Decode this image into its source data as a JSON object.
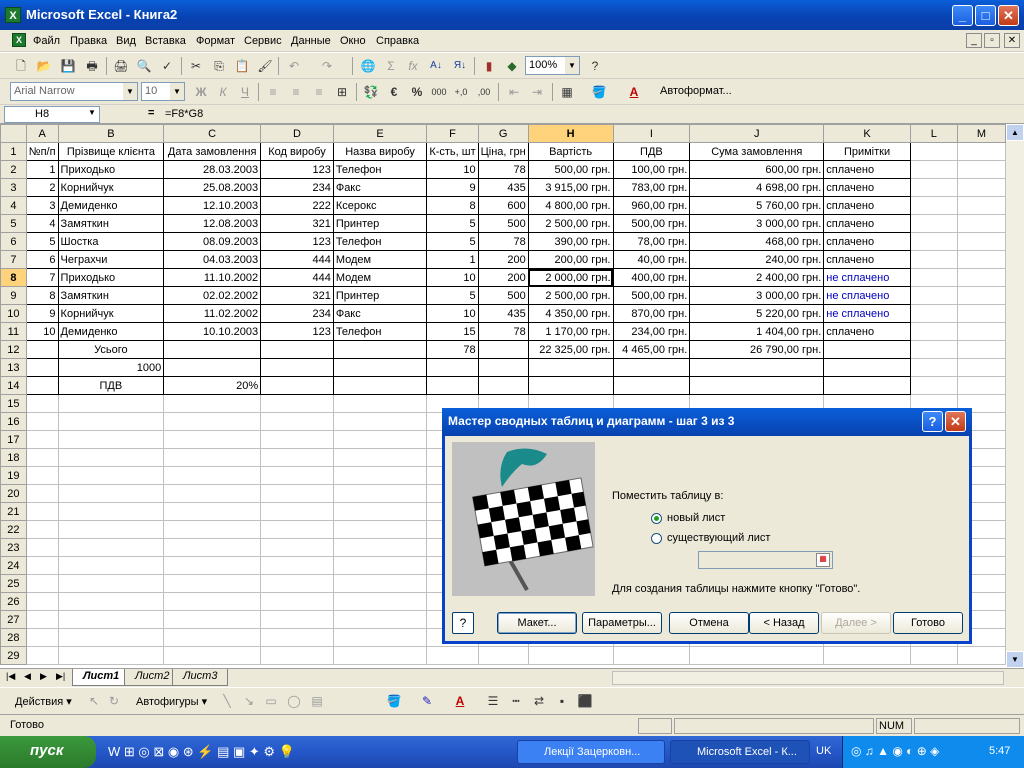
{
  "app": {
    "title": "Microsoft Excel - Книга2",
    "window_buttons": [
      "_",
      "□",
      "✕"
    ]
  },
  "menu": [
    "Файл",
    "Правка",
    "Вид",
    "Вставка",
    "Формат",
    "Сервис",
    "Данные",
    "Окно",
    "Справка"
  ],
  "toolbar": {
    "zoom": "100%",
    "font": "Arial Narrow",
    "size": "10",
    "autoformat": "Автоформат..."
  },
  "formula_bar": {
    "cell": "H8",
    "eq": "=",
    "formula": "=F8*G8"
  },
  "columns": [
    "A",
    "B",
    "C",
    "D",
    "E",
    "F",
    "G",
    "H",
    "I",
    "J",
    "K",
    "L",
    "M"
  ],
  "rows": [
    [
      "№п/п",
      "Прізвище клієнта",
      "Дата замовлення",
      "Код виробу",
      "Назва виробу",
      "К-сть, шт",
      "Ціна, грн",
      "Вартість",
      "ПДВ",
      "Сума замовлення",
      "Примітки",
      "",
      ""
    ],
    [
      "1",
      "Приходько",
      "28.03.2003",
      "123",
      "Телефон",
      "10",
      "78",
      "500,00 грн.",
      "100,00 грн.",
      "600,00 грн.",
      "сплачено",
      "",
      ""
    ],
    [
      "2",
      "Корнийчук",
      "25.08.2003",
      "234",
      "Факс",
      "9",
      "435",
      "3 915,00 грн.",
      "783,00 грн.",
      "4 698,00 грн.",
      "сплачено",
      "",
      ""
    ],
    [
      "3",
      "Демиденко",
      "12.10.2003",
      "222",
      "Ксерокс",
      "8",
      "600",
      "4 800,00 грн.",
      "960,00 грн.",
      "5 760,00 грн.",
      "сплачено",
      "",
      ""
    ],
    [
      "4",
      "Замяткин",
      "12.08.2003",
      "321",
      "Принтер",
      "5",
      "500",
      "2 500,00 грн.",
      "500,00 грн.",
      "3 000,00 грн.",
      "сплачено",
      "",
      ""
    ],
    [
      "5",
      "Шостка",
      "08.09.2003",
      "123",
      "Телефон",
      "5",
      "78",
      "390,00 грн.",
      "78,00 грн.",
      "468,00 грн.",
      "сплачено",
      "",
      ""
    ],
    [
      "6",
      "Чеграхчи",
      "04.03.2003",
      "444",
      "Модем",
      "1",
      "200",
      "200,00 грн.",
      "40,00 грн.",
      "240,00 грн.",
      "сплачено",
      "",
      ""
    ],
    [
      "7",
      "Приходько",
      "11.10.2002",
      "444",
      "Модем",
      "10",
      "200",
      "2 000,00 грн.",
      "400,00 грн.",
      "2 400,00 грн.",
      "не сплачено",
      "",
      ""
    ],
    [
      "8",
      "Замяткин",
      "02.02.2002",
      "321",
      "Принтер",
      "5",
      "500",
      "2 500,00 грн.",
      "500,00 грн.",
      "3 000,00 грн.",
      "не сплачено",
      "",
      ""
    ],
    [
      "9",
      "Корнийчук",
      "11.02.2002",
      "234",
      "Факс",
      "10",
      "435",
      "4 350,00 грн.",
      "870,00 грн.",
      "5 220,00 грн.",
      "не сплачено",
      "",
      ""
    ],
    [
      "10",
      "Демиденко",
      "10.10.2003",
      "123",
      "Телефон",
      "15",
      "78",
      "1 170,00 грн.",
      "234,00 грн.",
      "1 404,00 грн.",
      "сплачено",
      "",
      ""
    ],
    [
      "",
      "Усього",
      "",
      "",
      "",
      "78",
      "",
      "22 325,00 грн.",
      "4 465,00 грн.",
      "26 790,00 грн.",
      "",
      "",
      ""
    ],
    [
      "",
      "1000",
      "",
      "",
      "",
      "",
      "",
      "",
      "",
      "",
      "",
      "",
      ""
    ],
    [
      "",
      "ПДВ",
      "20%",
      "",
      "",
      "",
      "",
      "",
      "",
      "",
      "",
      "",
      ""
    ]
  ],
  "sheet_tabs": [
    "Лист1",
    "Лист2",
    "Лист3"
  ],
  "drawbar": {
    "actions": "Действия",
    "autoshapes": "Автофигуры"
  },
  "status": {
    "left": "Готово",
    "num": "NUM"
  },
  "dialog": {
    "title": "Мастер сводных таблиц и диаграмм - шаг 3 из 3",
    "place_label": "Поместить таблицу в:",
    "opt_new": "новый лист",
    "opt_existing": "существующий лист",
    "hint": "Для создания таблицы нажмите кнопку \"Готово\".",
    "buttons": {
      "layout": "Макет...",
      "params": "Параметры...",
      "cancel": "Отмена",
      "back": "< Назад",
      "next": "Далее >",
      "finish": "Готово"
    }
  },
  "taskbar": {
    "start": "пуск",
    "task1": "Лекції Зацерковн...",
    "task2": "Microsoft Excel - К...",
    "lang": "UK",
    "clock": "5:47"
  }
}
